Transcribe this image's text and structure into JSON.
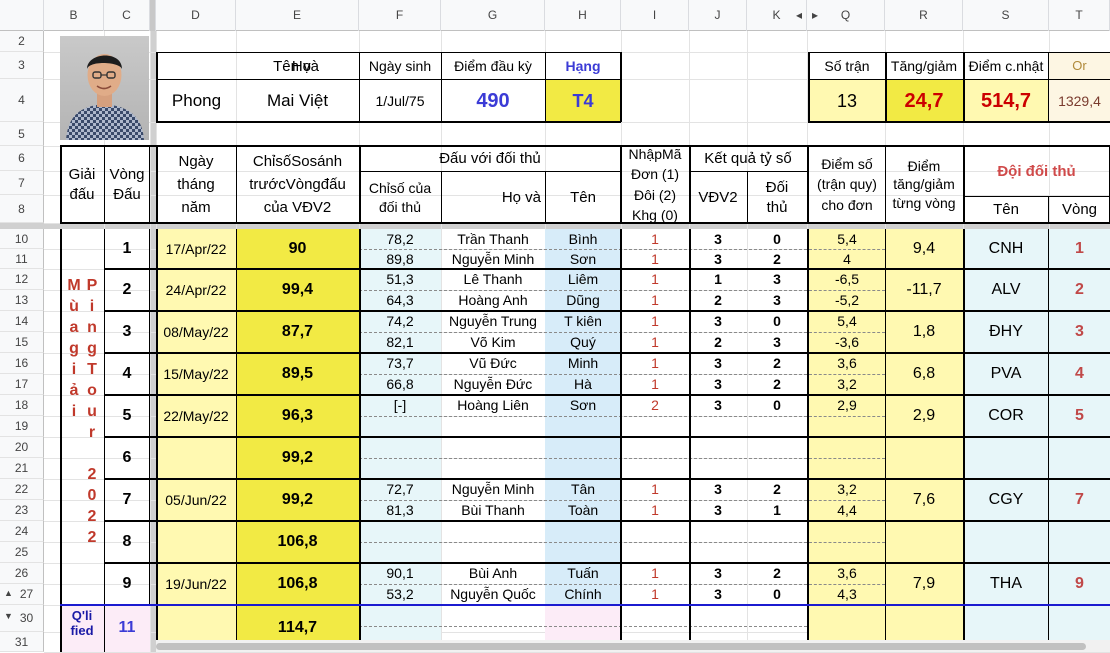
{
  "columns": [
    "B",
    "C",
    "D",
    "E",
    "F",
    "G",
    "H",
    "I",
    "J",
    "K",
    "Q",
    "R",
    "S",
    "T"
  ],
  "rows": [
    "2",
    "3",
    "4",
    "5",
    "6",
    "7",
    "8",
    "10",
    "11",
    "12",
    "13",
    "14",
    "15",
    "16",
    "17",
    "18",
    "19",
    "20",
    "21",
    "22",
    "23",
    "24",
    "25",
    "26",
    "27",
    "30",
    "31"
  ],
  "player": {
    "h_ten_va": "Tên    và",
    "h_ho": "Họ",
    "h_birth": "Ngày sinh",
    "h_score": "Điểm đầu kỳ",
    "h_rank": "Hạng",
    "first": "Phong",
    "last": "Mai Việt",
    "birth": "1/Jul/75",
    "score": "490",
    "rank": "T4"
  },
  "summary": {
    "h_matches": "Số trận",
    "h_change": "Tăng/giảm",
    "h_updated": "Điểm c.nhật",
    "h_or": "Or",
    "matches": "13",
    "change": "24,7",
    "updated": "514,7",
    "or": "1329,4"
  },
  "headers": {
    "tournament": "Giải đấu",
    "round": "Vòng Đấu",
    "date": "Ngày tháng năm",
    "index": "ChỉsốSosánh trướcVòngđấu của VĐV2",
    "vs": "Đấu với đối thủ",
    "opp_index": "Chỉsố của đối thủ",
    "ho": "Họ   và",
    "ten": "Tên",
    "entry": "NhậpMã Đơn (1) Đôi (2) Khg (0)",
    "result": "Kết quả tỷ số",
    "vdv2": "VĐV2",
    "opp": "Đối thủ",
    "points": "Điểm số (trận quy) cho đơn",
    "delta": "Điểm tăng/giảm từng vòng",
    "team": "Đội đối thủ",
    "team_name": "Tên",
    "team_round": "Vòng"
  },
  "tournament_name": "Mùa giải PingTour 2022",
  "tournament_letters": [
    "M",
    "ù",
    "a",
    "g",
    "i",
    "ả",
    "i"
  ],
  "tournament_letters2": [
    "P",
    "i",
    "n",
    "g",
    "T",
    "o",
    "u",
    "r",
    "2",
    "0",
    "2",
    "2"
  ],
  "rounds": [
    {
      "no": "1",
      "date": "17/Apr/22",
      "index": "90",
      "delta": "9,4",
      "team": "CNH",
      "team_round": "1",
      "matches": [
        {
          "oi": "78,2",
          "ho": "Trần Thanh",
          "ten": "Bình",
          "code": "1",
          "a": "3",
          "b": "0",
          "pts": "5,4"
        },
        {
          "oi": "89,8",
          "ho": "Nguyễn Minh",
          "ten": "Sơn",
          "code": "1",
          "a": "3",
          "b": "2",
          "pts": "4"
        }
      ]
    },
    {
      "no": "2",
      "date": "24/Apr/22",
      "index": "99,4",
      "delta": "-11,7",
      "team": "ALV",
      "team_round": "2",
      "matches": [
        {
          "oi": "51,3",
          "ho": "Lê Thanh",
          "ten": "Liêm",
          "code": "1",
          "a": "1",
          "b": "3",
          "pts": "-6,5"
        },
        {
          "oi": "64,3",
          "ho": "Hoàng Anh",
          "ten": "Dũng",
          "code": "1",
          "a": "2",
          "b": "3",
          "pts": "-5,2"
        }
      ]
    },
    {
      "no": "3",
      "date": "08/May/22",
      "index": "87,7",
      "delta": "1,8",
      "team": "ĐHY",
      "team_round": "3",
      "matches": [
        {
          "oi": "74,2",
          "ho": "Nguyễn Trung",
          "ten": "T kiên",
          "code": "1",
          "a": "3",
          "b": "0",
          "pts": "5,4"
        },
        {
          "oi": "82,1",
          "ho": "Võ Kim",
          "ten": "Quý",
          "code": "1",
          "a": "2",
          "b": "3",
          "pts": "-3,6"
        }
      ]
    },
    {
      "no": "4",
      "date": "15/May/22",
      "index": "89,5",
      "delta": "6,8",
      "team": "PVA",
      "team_round": "4",
      "matches": [
        {
          "oi": "73,7",
          "ho": "Vũ Đức",
          "ten": "Minh",
          "code": "1",
          "a": "3",
          "b": "2",
          "pts": "3,6"
        },
        {
          "oi": "66,8",
          "ho": "Nguyễn Đức",
          "ten": "Hà",
          "code": "1",
          "a": "3",
          "b": "2",
          "pts": "3,2"
        }
      ]
    },
    {
      "no": "5",
      "date": "22/May/22",
      "index": "96,3",
      "delta": "2,9",
      "team": "COR",
      "team_round": "5",
      "matches": [
        {
          "oi": "[-]",
          "ho": "Hoàng Liên",
          "ten": "Sơn",
          "code": "2",
          "a": "3",
          "b": "0",
          "pts": "2,9"
        },
        {
          "oi": "",
          "ho": "",
          "ten": "",
          "code": "",
          "a": "",
          "b": "",
          "pts": ""
        }
      ]
    },
    {
      "no": "6",
      "date": "",
      "index": "99,2",
      "delta": "",
      "team": "",
      "team_round": "",
      "matches": [
        {
          "oi": "",
          "ho": "",
          "ten": "",
          "code": "",
          "a": "",
          "b": "",
          "pts": ""
        },
        {
          "oi": "",
          "ho": "",
          "ten": "",
          "code": "",
          "a": "",
          "b": "",
          "pts": ""
        }
      ]
    },
    {
      "no": "7",
      "date": "05/Jun/22",
      "index": "99,2",
      "delta": "7,6",
      "team": "CGY",
      "team_round": "7",
      "matches": [
        {
          "oi": "72,7",
          "ho": "Nguyễn Minh",
          "ten": "Tân",
          "code": "1",
          "a": "3",
          "b": "2",
          "pts": "3,2"
        },
        {
          "oi": "81,3",
          "ho": "Bùi Thanh",
          "ten": "Toàn",
          "code": "1",
          "a": "3",
          "b": "1",
          "pts": "4,4"
        }
      ]
    },
    {
      "no": "8",
      "date": "",
      "index": "106,8",
      "delta": "",
      "team": "",
      "team_round": "",
      "matches": [
        {
          "oi": "",
          "ho": "",
          "ten": "",
          "code": "",
          "a": "",
          "b": "",
          "pts": ""
        },
        {
          "oi": "",
          "ho": "",
          "ten": "",
          "code": "",
          "a": "",
          "b": "",
          "pts": ""
        }
      ]
    },
    {
      "no": "9",
      "date": "19/Jun/22",
      "index": "106,8",
      "delta": "7,9",
      "team": "THA",
      "team_round": "9",
      "matches": [
        {
          "oi": "90,1",
          "ho": "Bùi Anh",
          "ten": "Tuấn",
          "code": "1",
          "a": "3",
          "b": "2",
          "pts": "3,6"
        },
        {
          "oi": "53,2",
          "ho": "Nguyễn Quốc",
          "ten": "Chính",
          "code": "1",
          "a": "3",
          "b": "0",
          "pts": "4,3"
        }
      ]
    }
  ],
  "next": {
    "label": "Q'li fied",
    "no": "11",
    "index": "114,7"
  },
  "icons": {
    "collapse": "triangle-left-icon",
    "expand": "triangle-right-icon",
    "row_up": "triangle-up-icon",
    "row_down": "triangle-down-icon"
  }
}
